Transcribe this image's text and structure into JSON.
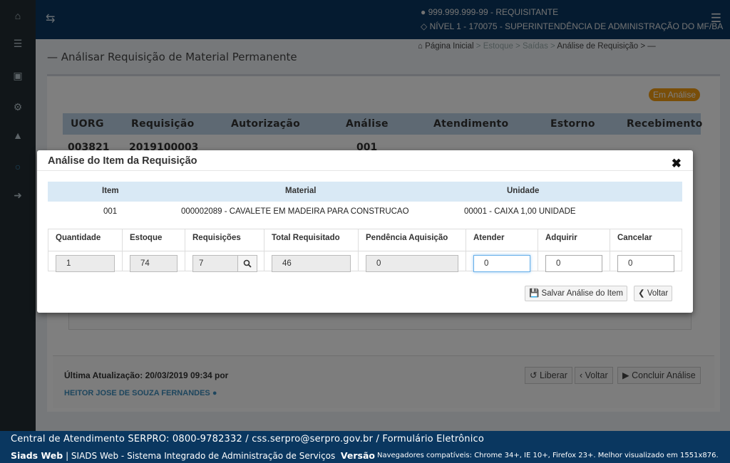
{
  "topbar": {
    "user": "999.999.999-99 - REQUISITANTE",
    "level": "NÍVEL 1 - 170075 - SUPERINTENDÊNCIA DE ADMINISTRAÇÃO DO MF/BA"
  },
  "page": {
    "title": "Análisar Requisição de Material Permanente",
    "breadcrumb": [
      "Página Inicial",
      "Estoque",
      "Saídas",
      "Análise de Requisição"
    ]
  },
  "background": {
    "status_badge": "Em Análise",
    "columns": [
      "UORG",
      "Requisição",
      "Autorização",
      "Análise",
      "Atendimento",
      "Estorno",
      "Recebimento"
    ],
    "row": {
      "uorg": "003821",
      "requisicao": "2019100003",
      "analise": "001"
    },
    "last_update_label": "Última Atualização: 20/03/2019 09:34 por",
    "last_update_user": "HEITOR JOSE DE SOUZA FERNANDES",
    "buttons": {
      "liberar": "Liberar",
      "voltar": "Voltar",
      "concluir": "Concluir Análise"
    }
  },
  "modal": {
    "title": "Análise do Item da Requisição",
    "item_table": {
      "headers": [
        "Item",
        "Material",
        "Unidade"
      ],
      "row": {
        "item": "001",
        "material": "000002089 - CAVALETE EM MADEIRA PARA CONSTRUCAO",
        "unidade": "00001 - CAIXA 1,00 UNIDADE"
      }
    },
    "fields": {
      "headers": [
        "Quantidade",
        "Estoque",
        "Requisições",
        "Total Requisitado",
        "Pendência Aquisição",
        "Atender",
        "Adquirir",
        "Cancelar"
      ],
      "quantidade": "1",
      "estoque": "74",
      "requisicoes": "7",
      "total_requisitado": "46",
      "pendencia_aquisicao": "0",
      "atender": "0",
      "adquirir": "0",
      "cancelar": "0"
    },
    "buttons": {
      "salvar": "Salvar Análise do Item",
      "voltar": "Voltar"
    }
  },
  "footer": {
    "line1": "Central de Atendimento SERPRO: 0800-9782332 / css.serpro@serpro.gov.br / Formulário Eletrônico",
    "app": "Siads Web",
    "app_desc": "| SIADS Web - Sistema Integrado de Administração de Serviços",
    "version_label": "Versão",
    "browsers": "Navegadores compatíveis: Chrome 34+, IE 10+, Firefox 23+. Melhor visualizado em 1551x876."
  }
}
